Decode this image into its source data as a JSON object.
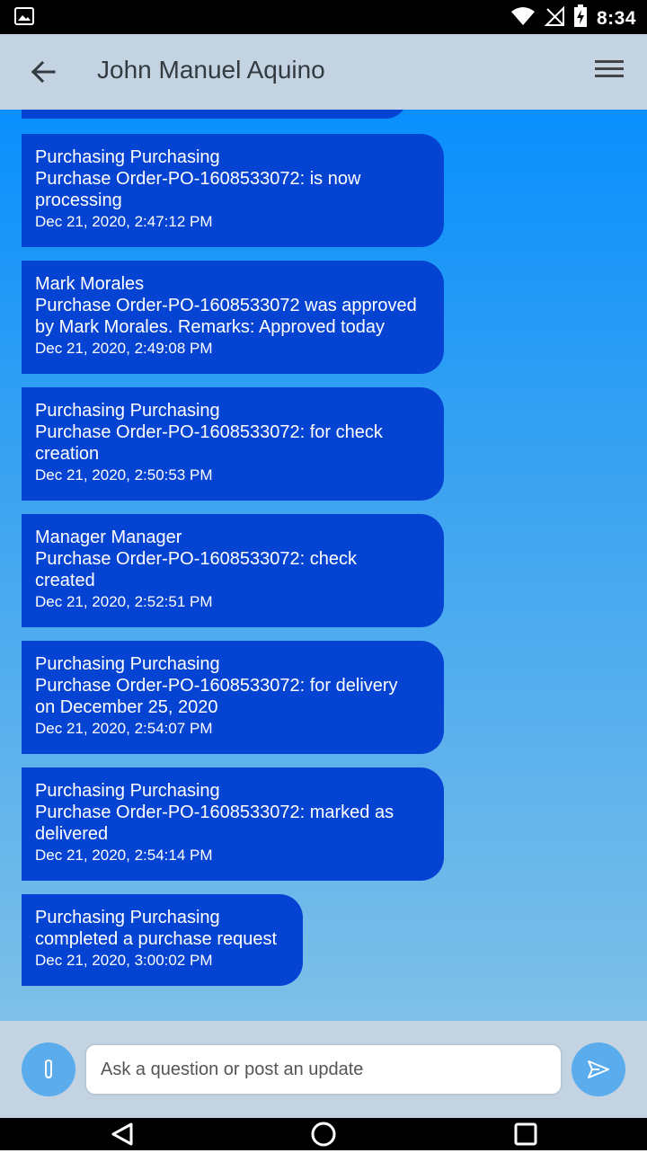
{
  "status_bar": {
    "time": "8:34",
    "icons": [
      "image-icon",
      "wifi-icon",
      "no-signal-icon",
      "battery-charging-icon"
    ]
  },
  "header": {
    "title": "John Manuel Aquino",
    "back_icon": "arrow-back-icon",
    "menu_icon": "hamburger-menu-icon"
  },
  "messages": [
    {
      "sender": "Purchasing Purchasing",
      "text_lines": [
        "Purchase Order-PO-1608533072: is now",
        "processing"
      ],
      "timestamp": "Dec 21, 2020, 2:47:12 PM"
    },
    {
      "sender": "Mark Morales",
      "text_lines": [
        "Purchase Order-PO-1608533072 was approved",
        "by Mark Morales. Remarks: Approved today"
      ],
      "timestamp": "Dec 21, 2020, 2:49:08 PM"
    },
    {
      "sender": "Purchasing Purchasing",
      "text_lines": [
        "Purchase Order-PO-1608533072: for check",
        "creation"
      ],
      "timestamp": "Dec 21, 2020, 2:50:53 PM"
    },
    {
      "sender": "Manager Manager",
      "text_lines": [
        "Purchase Order-PO-1608533072: check",
        "created"
      ],
      "timestamp": "Dec 21, 2020, 2:52:51 PM"
    },
    {
      "sender": "Purchasing Purchasing",
      "text_lines": [
        "Purchase Order-PO-1608533072: for delivery",
        "on December 25, 2020"
      ],
      "timestamp": "Dec 21, 2020, 2:54:07 PM"
    },
    {
      "sender": "Purchasing Purchasing",
      "text_lines": [
        "Purchase Order-PO-1608533072: marked as",
        "delivered"
      ],
      "timestamp": "Dec 21, 2020, 2:54:14 PM"
    },
    {
      "sender": "Purchasing Purchasing",
      "text_lines": [
        "completed a purchase request"
      ],
      "timestamp": "Dec 21, 2020, 3:00:02 PM"
    }
  ],
  "composer": {
    "placeholder": "Ask a question or post an update",
    "attach_icon": "paperclip-icon",
    "send_icon": "send-icon"
  },
  "nav_bar": {
    "icons": [
      "back-triangle-icon",
      "home-circle-icon",
      "recents-square-icon"
    ]
  },
  "colors": {
    "bubble": "#0543d2",
    "app_bar": "#c3d3e2",
    "accent_button": "#5aacec"
  }
}
